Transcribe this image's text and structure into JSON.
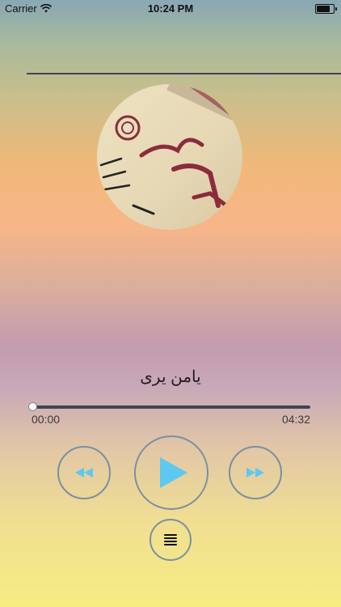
{
  "status_bar": {
    "carrier": "Carrier",
    "time": "10:24 PM",
    "battery_level": 0.9
  },
  "player": {
    "album_art": "quran-calligraphy-cover",
    "track_title": "يامن يرى",
    "elapsed_time": "00:00",
    "total_time": "04:32",
    "progress": 0.0
  },
  "controls": {
    "rewind_icon": "rewind-icon",
    "play_icon": "play-icon",
    "forward_icon": "fast-forward-icon",
    "menu_icon": "menu-icon"
  },
  "colors": {
    "accent_blue": "#5ec8f0",
    "ring": "#7c8fa2",
    "divider": "#3d4653"
  }
}
